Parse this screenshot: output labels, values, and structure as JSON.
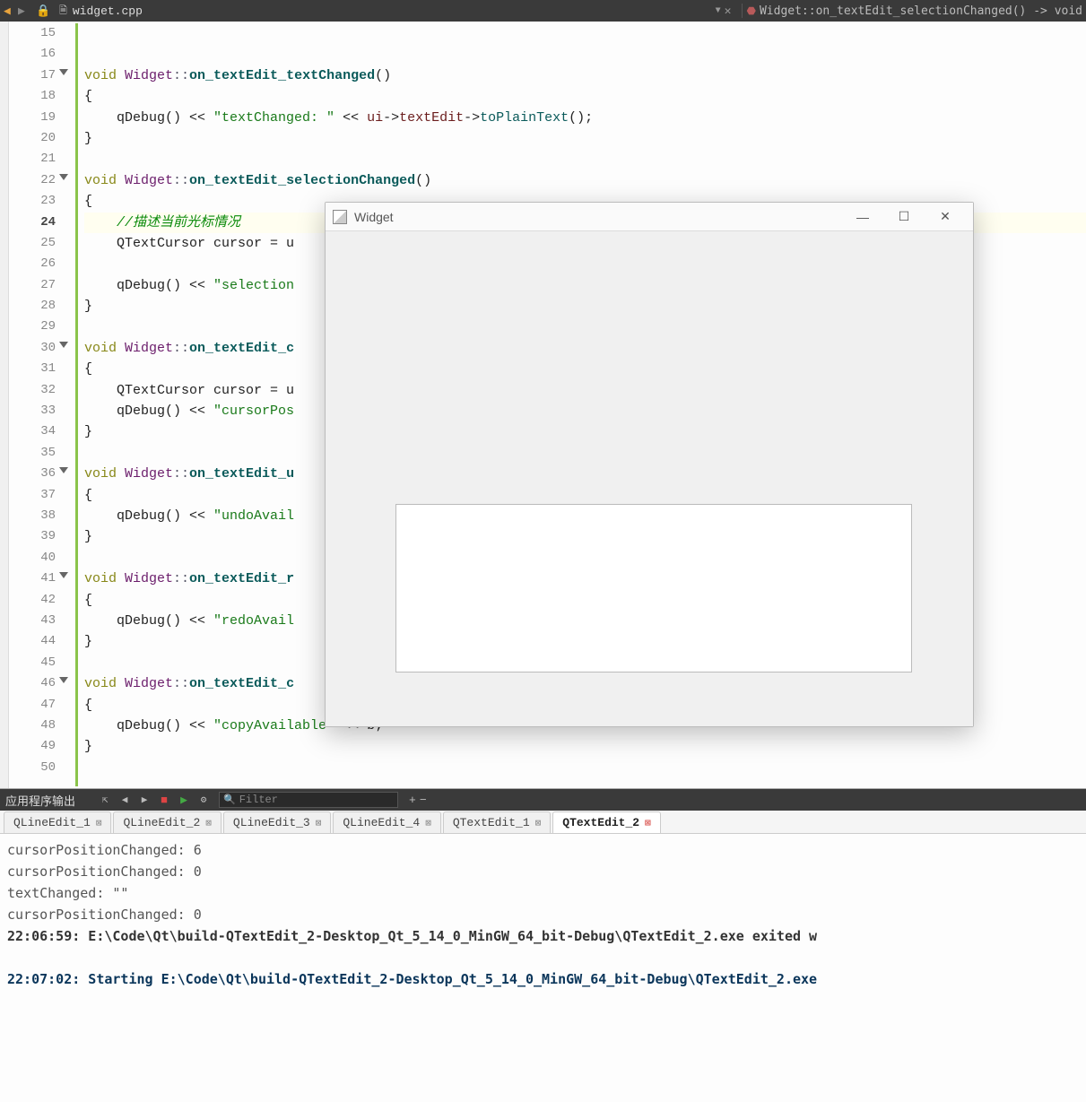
{
  "top_bar": {
    "file_name": "widget.cpp",
    "breadcrumb": "Widget::on_textEdit_selectionChanged() -> void"
  },
  "gutter": {
    "start": 15,
    "end": 50,
    "current": 24,
    "fold_lines": [
      17,
      22,
      30,
      36,
      41,
      46
    ]
  },
  "code_lines": [
    {
      "n": 15,
      "segs": []
    },
    {
      "n": 16,
      "segs": []
    },
    {
      "n": 17,
      "segs": [
        {
          "t": "void ",
          "c": "kw"
        },
        {
          "t": "Widget",
          "c": "cls"
        },
        {
          "t": "::",
          "c": "op"
        },
        {
          "t": "on_textEdit_textChanged",
          "c": "fn"
        },
        {
          "t": "()",
          "c": ""
        }
      ]
    },
    {
      "n": 18,
      "segs": [
        {
          "t": "{",
          "c": ""
        }
      ]
    },
    {
      "n": 19,
      "segs": [
        {
          "t": "    qDebug() << ",
          "c": ""
        },
        {
          "t": "\"textChanged: \"",
          "c": "str"
        },
        {
          "t": " << ",
          "c": ""
        },
        {
          "t": "ui",
          "c": "mem"
        },
        {
          "t": "->",
          "c": ""
        },
        {
          "t": "textEdit",
          "c": "mem"
        },
        {
          "t": "->",
          "c": ""
        },
        {
          "t": "toPlainText",
          "c": "meth"
        },
        {
          "t": "();",
          "c": ""
        }
      ]
    },
    {
      "n": 20,
      "segs": [
        {
          "t": "}",
          "c": ""
        }
      ]
    },
    {
      "n": 21,
      "segs": []
    },
    {
      "n": 22,
      "segs": [
        {
          "t": "void ",
          "c": "kw"
        },
        {
          "t": "Widget",
          "c": "cls"
        },
        {
          "t": "::",
          "c": "op"
        },
        {
          "t": "on_textEdit_selectionChanged",
          "c": "fn"
        },
        {
          "t": "()",
          "c": ""
        }
      ]
    },
    {
      "n": 23,
      "segs": [
        {
          "t": "{",
          "c": ""
        }
      ]
    },
    {
      "n": 24,
      "segs": [
        {
          "t": "    ",
          "c": ""
        },
        {
          "t": "//描述当前光标情况",
          "c": "cmt"
        }
      ]
    },
    {
      "n": 25,
      "segs": [
        {
          "t": "    QTextCursor cursor = u",
          "c": ""
        }
      ]
    },
    {
      "n": 26,
      "segs": []
    },
    {
      "n": 27,
      "segs": [
        {
          "t": "    qDebug() << ",
          "c": ""
        },
        {
          "t": "\"selection",
          "c": "str"
        }
      ]
    },
    {
      "n": 28,
      "segs": [
        {
          "t": "}",
          "c": ""
        }
      ]
    },
    {
      "n": 29,
      "segs": []
    },
    {
      "n": 30,
      "segs": [
        {
          "t": "void ",
          "c": "kw"
        },
        {
          "t": "Widget",
          "c": "cls"
        },
        {
          "t": "::",
          "c": "op"
        },
        {
          "t": "on_textEdit_c",
          "c": "fn"
        }
      ]
    },
    {
      "n": 31,
      "segs": [
        {
          "t": "{",
          "c": ""
        }
      ]
    },
    {
      "n": 32,
      "segs": [
        {
          "t": "    QTextCursor cursor = u",
          "c": ""
        }
      ]
    },
    {
      "n": 33,
      "segs": [
        {
          "t": "    qDebug() << ",
          "c": ""
        },
        {
          "t": "\"cursorPos",
          "c": "str"
        }
      ]
    },
    {
      "n": 34,
      "segs": [
        {
          "t": "}",
          "c": ""
        }
      ]
    },
    {
      "n": 35,
      "segs": []
    },
    {
      "n": 36,
      "segs": [
        {
          "t": "void ",
          "c": "kw"
        },
        {
          "t": "Widget",
          "c": "cls"
        },
        {
          "t": "::",
          "c": "op"
        },
        {
          "t": "on_textEdit_u",
          "c": "fn"
        }
      ]
    },
    {
      "n": 37,
      "segs": [
        {
          "t": "{",
          "c": ""
        }
      ]
    },
    {
      "n": 38,
      "segs": [
        {
          "t": "    qDebug() << ",
          "c": ""
        },
        {
          "t": "\"undoAvail",
          "c": "str"
        }
      ]
    },
    {
      "n": 39,
      "segs": [
        {
          "t": "}",
          "c": ""
        }
      ]
    },
    {
      "n": 40,
      "segs": []
    },
    {
      "n": 41,
      "segs": [
        {
          "t": "void ",
          "c": "kw"
        },
        {
          "t": "Widget",
          "c": "cls"
        },
        {
          "t": "::",
          "c": "op"
        },
        {
          "t": "on_textEdit_r",
          "c": "fn"
        }
      ]
    },
    {
      "n": 42,
      "segs": [
        {
          "t": "{",
          "c": ""
        }
      ]
    },
    {
      "n": 43,
      "segs": [
        {
          "t": "    qDebug() << ",
          "c": ""
        },
        {
          "t": "\"redoAvail",
          "c": "str"
        }
      ]
    },
    {
      "n": 44,
      "segs": [
        {
          "t": "}",
          "c": ""
        }
      ]
    },
    {
      "n": 45,
      "segs": []
    },
    {
      "n": 46,
      "segs": [
        {
          "t": "void ",
          "c": "kw"
        },
        {
          "t": "Widget",
          "c": "cls"
        },
        {
          "t": "::",
          "c": "op"
        },
        {
          "t": "on_textEdit_c",
          "c": "fn"
        }
      ]
    },
    {
      "n": 47,
      "segs": [
        {
          "t": "{",
          "c": ""
        }
      ]
    },
    {
      "n": 48,
      "segs": [
        {
          "t": "    qDebug() << ",
          "c": ""
        },
        {
          "t": "\"copyAvailable\"",
          "c": "str"
        },
        {
          "t": " << b;",
          "c": ""
        }
      ]
    },
    {
      "n": 49,
      "segs": [
        {
          "t": "}",
          "c": ""
        }
      ]
    },
    {
      "n": 50,
      "segs": []
    }
  ],
  "panel": {
    "title": "应用程序输出",
    "filter_placeholder": "Filter"
  },
  "output_tabs": [
    {
      "label": "QLineEdit_1",
      "active": false
    },
    {
      "label": "QLineEdit_2",
      "active": false
    },
    {
      "label": "QLineEdit_3",
      "active": false
    },
    {
      "label": "QLineEdit_4",
      "active": false
    },
    {
      "label": "QTextEdit_1",
      "active": false
    },
    {
      "label": "QTextEdit_2",
      "active": true
    }
  ],
  "output_lines": [
    {
      "text": "cursorPositionChanged:  6",
      "style": "normal"
    },
    {
      "text": "cursorPositionChanged:  0",
      "style": "normal"
    },
    {
      "text": "textChanged:  \"\"",
      "style": "normal"
    },
    {
      "text": "cursorPositionChanged:  0",
      "style": "normal"
    },
    {
      "text": "22:06:59: E:\\Code\\Qt\\build-QTextEdit_2-Desktop_Qt_5_14_0_MinGW_64_bit-Debug\\QTextEdit_2.exe exited w",
      "style": "bold"
    },
    {
      "text": "",
      "style": "normal"
    },
    {
      "text": "22:07:02: Starting E:\\Code\\Qt\\build-QTextEdit_2-Desktop_Qt_5_14_0_MinGW_64_bit-Debug\\QTextEdit_2.exe",
      "style": "bold-blue"
    }
  ],
  "widget_window": {
    "title": "Widget"
  }
}
